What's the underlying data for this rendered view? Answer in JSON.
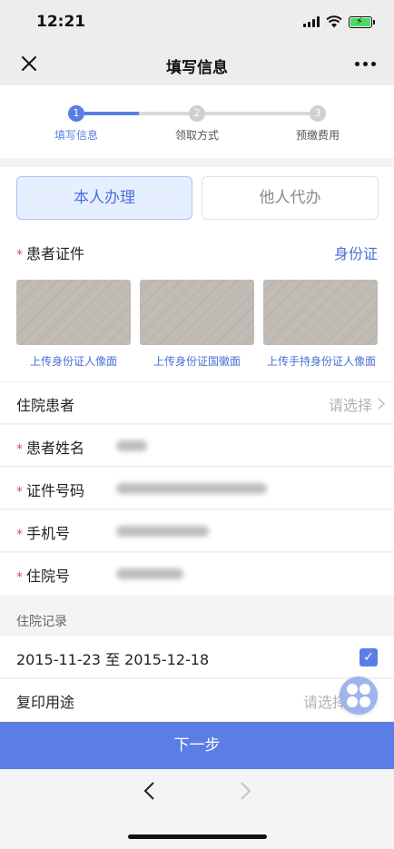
{
  "status_bar": {
    "time": "12:21",
    "signal_icon": "signal-bars-icon",
    "wifi_icon": "wifi-icon",
    "battery_icon": "battery-charging-icon"
  },
  "nav": {
    "title": "填写信息",
    "close_icon": "close-icon",
    "more_icon": "more-horizontal-icon"
  },
  "steps": [
    {
      "number": "1",
      "label": "填写信息",
      "active": true
    },
    {
      "number": "2",
      "label": "领取方式",
      "active": false
    },
    {
      "number": "3",
      "label": "预缴费用",
      "active": false
    }
  ],
  "applicant_toggle": {
    "self_label": "本人办理",
    "other_label": "他人代办",
    "selected": "本人办理"
  },
  "id_section": {
    "required_mark": "*",
    "label": "患者证件",
    "id_type": "身份证",
    "uploads": [
      {
        "label": "上传身份证人像面"
      },
      {
        "label": "上传身份证国徽面"
      },
      {
        "label": "上传手持身份证人像面"
      }
    ]
  },
  "form": {
    "inpatient": {
      "label": "住院患者",
      "placeholder": "请选择",
      "chevron_icon": "chevron-right-icon"
    },
    "name": {
      "required_mark": "*",
      "label": "患者姓名"
    },
    "id_number": {
      "required_mark": "*",
      "label": "证件号码"
    },
    "phone": {
      "required_mark": "*",
      "label": "手机号"
    },
    "admission_no": {
      "required_mark": "*",
      "label": "住院号"
    }
  },
  "records": {
    "header": "住院记录",
    "items": [
      {
        "range": "2015-11-23 至 2015-12-18",
        "checked": true,
        "check_icon": "checkmark-icon"
      }
    ]
  },
  "purpose": {
    "label": "复印用途",
    "placeholder": "请选择"
  },
  "float_menu_icon": "clover-menu-icon",
  "next_button": "下一步",
  "bottom_nav": {
    "back_icon": "chevron-left-icon",
    "forward_icon": "chevron-right-icon"
  },
  "colors": {
    "accent": "#5b7ee6",
    "required": "#e34b4b",
    "accent_text": "#4a6fd8"
  }
}
